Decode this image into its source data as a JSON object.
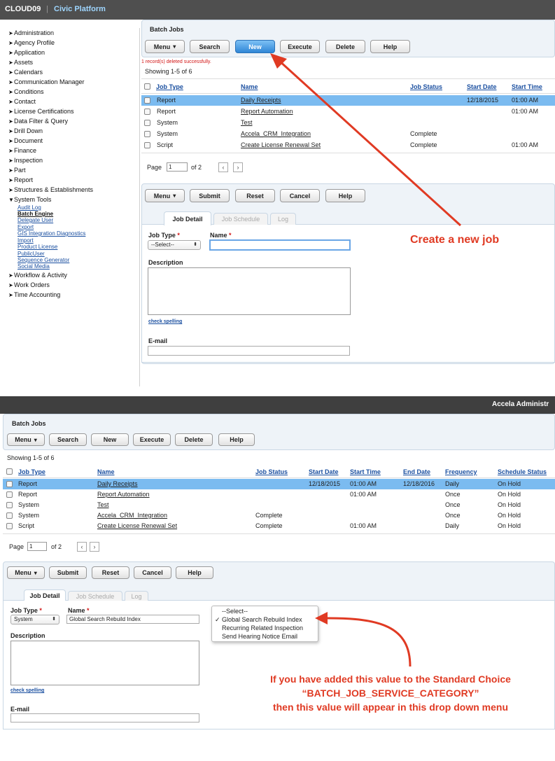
{
  "app": {
    "brand": "CLOUD09",
    "separator": "|",
    "platform": "Civic Platform",
    "admin_title": "Accela Administr"
  },
  "sidebar": {
    "items": [
      {
        "label": "Administration"
      },
      {
        "label": "Agency Profile"
      },
      {
        "label": "Application"
      },
      {
        "label": "Assets"
      },
      {
        "label": "Calendars"
      },
      {
        "label": "Communication Manager"
      },
      {
        "label": "Conditions"
      },
      {
        "label": "Contact"
      },
      {
        "label": "License Certifications"
      },
      {
        "label": "Data Filter & Query"
      },
      {
        "label": "Drill Down"
      },
      {
        "label": "Document"
      },
      {
        "label": "Finance"
      },
      {
        "label": "Inspection"
      },
      {
        "label": "Part"
      },
      {
        "label": "Report"
      },
      {
        "label": "Structures & Establishments"
      },
      {
        "label": "System Tools"
      }
    ],
    "system_tools_sub": [
      "Audit Log",
      "Batch Engine",
      "Delegate User",
      "Export",
      "GIS Integration Diagnostics",
      "Import",
      "Product License",
      "PublicUser",
      "Sequence Generator",
      "Social Media"
    ],
    "items_after": [
      {
        "label": "Workflow & Activity"
      },
      {
        "label": "Work Orders"
      },
      {
        "label": "Time Accounting"
      }
    ],
    "collapsed_arrow": "➤",
    "expanded_arrow": "▼"
  },
  "batch": {
    "title": "Batch Jobs",
    "toolbar": {
      "menu": "Menu",
      "search": "Search",
      "new": "New",
      "execute": "Execute",
      "delete": "Delete",
      "help": "Help"
    },
    "message": "1 record(s) deleted successfully.",
    "showing": "Showing 1-5 of 6",
    "columns": [
      "Job Type",
      "Name",
      "Job Status",
      "Start Date",
      "Start Time",
      "End Date",
      "Frequency",
      "Schedule Status"
    ],
    "rows": [
      {
        "type": "Report",
        "name": "Daily Receipts",
        "status": "",
        "start_date": "12/18/2015",
        "start_time": "01:00 AM",
        "end_date": "12/18/2016",
        "frequency": "Daily",
        "schedule": "On Hold"
      },
      {
        "type": "Report",
        "name": "Report Automation",
        "status": "",
        "start_date": "",
        "start_time": "01:00 AM",
        "end_date": "",
        "frequency": "Once",
        "schedule": "On Hold"
      },
      {
        "type": "System",
        "name": "Test",
        "status": "",
        "start_date": "",
        "start_time": "",
        "end_date": "",
        "frequency": "Once",
        "schedule": "On Hold"
      },
      {
        "type": "System",
        "name": "Accela_CRM_Integration",
        "status": "Complete",
        "start_date": "",
        "start_time": "",
        "end_date": "",
        "frequency": "Once",
        "schedule": "On Hold"
      },
      {
        "type": "Script",
        "name": "Create License Renewal Set",
        "status": "Complete",
        "start_date": "",
        "start_time": "01:00 AM",
        "end_date": "",
        "frequency": "Daily",
        "schedule": "On Hold"
      }
    ],
    "pager": {
      "label": "Page",
      "page": "1",
      "of": "of 2",
      "prev": "‹",
      "next": "›"
    }
  },
  "detail": {
    "toolbar": {
      "menu": "Menu",
      "submit": "Submit",
      "reset": "Reset",
      "cancel": "Cancel",
      "help": "Help"
    },
    "tabs": [
      "Job Detail",
      "Job Schedule",
      "Log"
    ],
    "job_type_label": "Job Type",
    "name_label": "Name",
    "required_mark": "*",
    "job_type_value_1": "--Select--",
    "job_type_value_2": "System",
    "name_value_2": "Global Search Rebuild Index",
    "description_label": "Description",
    "check_spelling": "check spelling",
    "email_label": "E-mail"
  },
  "dropdown": {
    "options": [
      "--Select--",
      "Global Search Rebuild Index",
      "Recurring Related Inspection",
      "Send Hearing Notice Email"
    ],
    "check": "✓"
  },
  "annotations": {
    "create_job": "Create a new job",
    "note_line1": "If you have added this value to the Standard Choice",
    "note_line2": "“BATCH_JOB_SERVICE_CATEGORY”",
    "note_line3": "then this value will appear in this drop down menu"
  },
  "colors": {
    "annotation": "#e03a23",
    "selected_row": "#7bbbf0",
    "link": "#1a4fa0",
    "panel": "#eef3f8"
  }
}
